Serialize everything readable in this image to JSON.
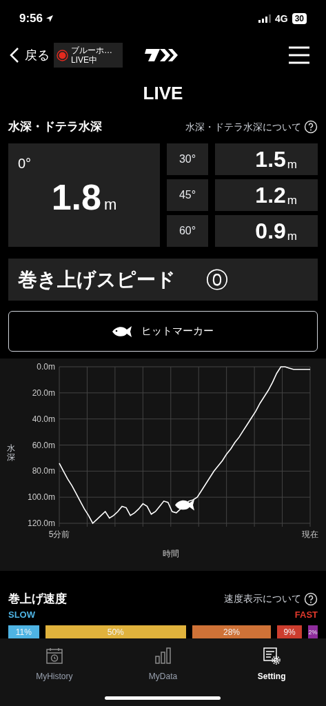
{
  "status_bar": {
    "time": "9:56",
    "network": "4G",
    "battery": "30"
  },
  "nav": {
    "back": "戻る",
    "live_badge": {
      "name": "ブルーホ…",
      "status": "LIVE中"
    }
  },
  "title": "LIVE",
  "depth": {
    "heading": "水深・ドテラ水深",
    "help": "水深・ドテラ水深について",
    "main": {
      "angle": "0°",
      "value": "1.8",
      "unit": "m"
    },
    "angles": [
      {
        "angle": "30°",
        "value": "1.5",
        "unit": "m"
      },
      {
        "angle": "45°",
        "value": "1.2",
        "unit": "m"
      },
      {
        "angle": "60°",
        "value": "0.9",
        "unit": "m"
      }
    ]
  },
  "reel_speed": {
    "label": "巻き上げスピード",
    "value": "⓪"
  },
  "hit_marker": {
    "label": "ヒットマーカー"
  },
  "chart": {
    "chart_data": {
      "type": "line",
      "xlabel": "時間",
      "ylabel": "水深",
      "ylim": [
        120,
        0
      ],
      "grid": true,
      "categories": [
        "5分前",
        null,
        null,
        null,
        null,
        null,
        null,
        null,
        null,
        null,
        null,
        null,
        null,
        null,
        null,
        null,
        null,
        null,
        null,
        null,
        null,
        null,
        null,
        null,
        null,
        null,
        null,
        null,
        null,
        null,
        null,
        null,
        null,
        null,
        null,
        null,
        null,
        null,
        null,
        null,
        null,
        null,
        null,
        null,
        null,
        null,
        null,
        null,
        null,
        null,
        null,
        null,
        null,
        null,
        null,
        null,
        null,
        null,
        null,
        null,
        "現在"
      ],
      "yticks": [
        {
          "value": 0,
          "label": "0.0m"
        },
        {
          "value": 20,
          "label": "20.0m"
        },
        {
          "value": 40,
          "label": "40.0m"
        },
        {
          "value": 60,
          "label": "60.0m"
        },
        {
          "value": 80,
          "label": "80.0m"
        },
        {
          "value": 100,
          "label": "100.0m"
        },
        {
          "value": 120,
          "label": "120.0m"
        }
      ],
      "series": [
        {
          "color": "#ffffff",
          "values": [
            74,
            80,
            86,
            91,
            97,
            103,
            109,
            114,
            120,
            117,
            114,
            111,
            116,
            114,
            111,
            107,
            108,
            114,
            112,
            109,
            105,
            107,
            113,
            111,
            107,
            103,
            104,
            111,
            112,
            109,
            106,
            103,
            102,
            100,
            95,
            90,
            85,
            80,
            76,
            72,
            67,
            63,
            58,
            54,
            49,
            44,
            39,
            34,
            28,
            23,
            18,
            12,
            5,
            0,
            0,
            1,
            2,
            2,
            2,
            2,
            2
          ]
        }
      ]
    }
  },
  "speed": {
    "heading": "巻上げ速度",
    "help": "速度表示について",
    "slow": "SLOW",
    "fast": "FAST",
    "bars": [
      {
        "label": "11%",
        "color": "#4eb3e3"
      },
      {
        "label": "50%",
        "color": "#e0b23c"
      },
      {
        "label": "28%",
        "color": "#cf7237"
      },
      {
        "label": "9%",
        "color": "#cc3d2e"
      },
      {
        "label": "2%",
        "color": "#8e2c9c"
      }
    ]
  },
  "tabs": [
    {
      "label": "MyHistory",
      "kind": "history",
      "selected": false
    },
    {
      "label": "MyData",
      "kind": "data",
      "selected": false
    },
    {
      "label": "Setting",
      "kind": "setting",
      "selected": true
    }
  ]
}
